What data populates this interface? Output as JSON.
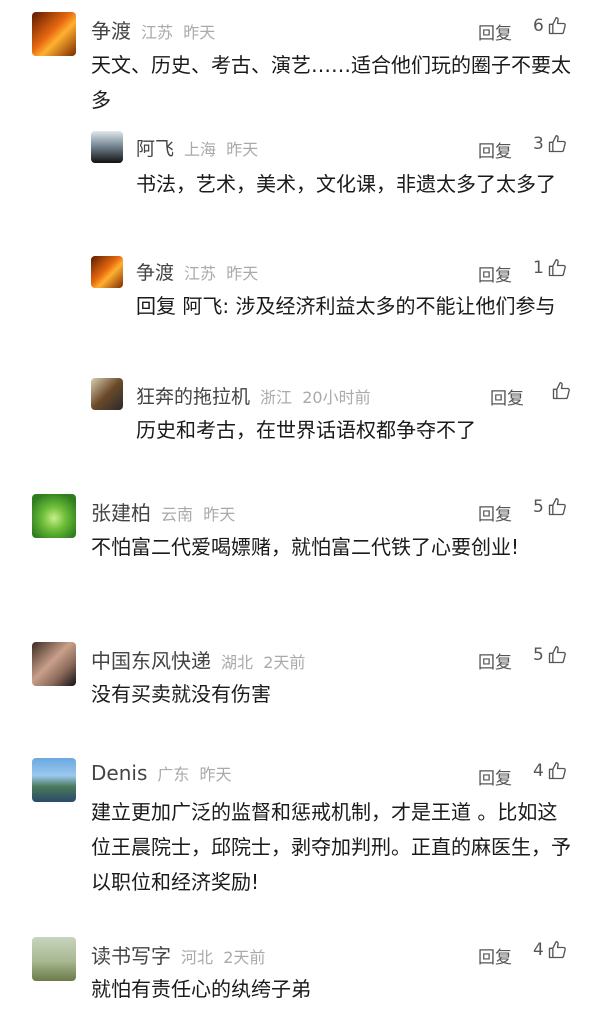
{
  "actions": {
    "reply": "回复"
  },
  "comments": [
    {
      "user": "争渡",
      "location": "江苏",
      "time": "昨天",
      "likes": "6",
      "text": "天文、历史、考古、演艺……适合他们玩的圈子不要太多",
      "replies": [
        {
          "user": "阿飞",
          "location": "上海",
          "time": "昨天",
          "likes": "3",
          "text": "书法，艺术，美术，文化课，非遗太多了太多了"
        },
        {
          "user": "争渡",
          "location": "江苏",
          "time": "昨天",
          "likes": "1",
          "reply_prefix": "回复 阿飞:",
          "text": " 涉及经济利益太多的不能让他们参与"
        },
        {
          "user": "狂奔的拖拉机",
          "location": "浙江",
          "time": "20小时前",
          "likes": "",
          "text": "历史和考古，在世界话语权都争夺不了"
        }
      ]
    },
    {
      "user": "张建柏",
      "location": "云南",
      "time": "昨天",
      "likes": "5",
      "text": "不怕富二代爱喝嫖赌，就怕富二代铁了心要创业!"
    },
    {
      "user": "中国东风快递",
      "location": "湖北",
      "time": "2天前",
      "likes": "5",
      "text": "没有买卖就没有伤害"
    },
    {
      "user": "Denis",
      "location": "广东",
      "time": "昨天",
      "likes": "4",
      "text": "建立更加广泛的监督和惩戒机制，才是王道 。比如这位王晨院士，邱院士，剥夺加判刑。正直的麻医生，予以职位和经济奖励!"
    },
    {
      "user": "读书写字",
      "location": "河北",
      "time": "2天前",
      "likes": "4",
      "text": "就怕有责任心的纨绔子弟"
    }
  ]
}
